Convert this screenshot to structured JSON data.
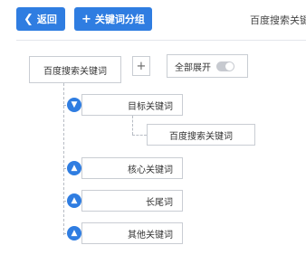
{
  "toolbar": {
    "back_label": "返回",
    "add_label": "关键词分组",
    "title": "百度搜索关键词"
  },
  "tree": {
    "root_label": "百度搜索关键词",
    "plus_label": "+",
    "switch_label": "全部展开",
    "switch_on": false,
    "nodes": [
      {
        "label": "目标关键词",
        "expanded": true
      },
      {
        "label": "核心关键词",
        "expanded": false
      },
      {
        "label": "长尾词",
        "expanded": false
      },
      {
        "label": "其他关键词",
        "expanded": false
      }
    ],
    "child_label": "百度搜索关键词"
  },
  "colors": {
    "accent": "#2f7de1"
  },
  "icons": {
    "back": "chevron-left-icon",
    "add": "plus-icon",
    "collapse": "chevron-down-icon",
    "expand": "chevron-up-icon"
  }
}
